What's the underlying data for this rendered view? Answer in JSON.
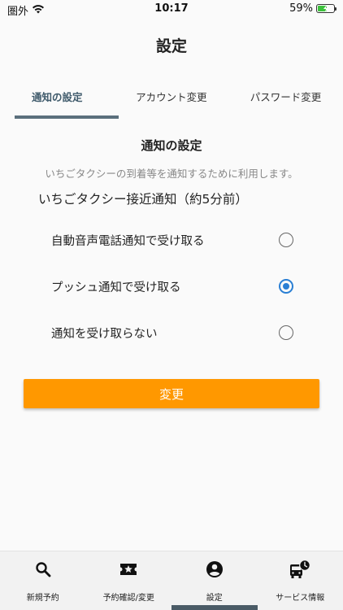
{
  "status_bar": {
    "carrier": "圏外",
    "time": "10:17",
    "battery_percent": "59%",
    "battery_level": 0.59
  },
  "page": {
    "title": "設定"
  },
  "tabs": [
    {
      "label": "通知の設定",
      "active": true
    },
    {
      "label": "アカウント変更",
      "active": false
    },
    {
      "label": "パスワード変更",
      "active": false
    }
  ],
  "notification": {
    "title": "通知の設定",
    "description": "いちごタクシーの到着等を通知するために利用します。",
    "group_heading": "いちごタクシー接近通知（約5分前）",
    "options": [
      {
        "label": "自動音声電話通知で受け取る",
        "selected": false
      },
      {
        "label": "プッシュ通知で受け取る",
        "selected": true
      },
      {
        "label": "通知を受け取らない",
        "selected": false
      }
    ],
    "submit_label": "変更"
  },
  "bottom_nav": [
    {
      "label": "新規予約",
      "icon": "search-icon",
      "active": false
    },
    {
      "label": "予約確認/変更",
      "icon": "ticket-star-icon",
      "active": false
    },
    {
      "label": "設定",
      "icon": "account-circle-icon",
      "active": true
    },
    {
      "label": "サービス情報",
      "icon": "bus-clock-icon",
      "active": false
    }
  ],
  "colors": {
    "accent_button": "#ff9800",
    "radio_selected": "#2a7fd4",
    "tab_indicator": "#5a6f7c"
  }
}
